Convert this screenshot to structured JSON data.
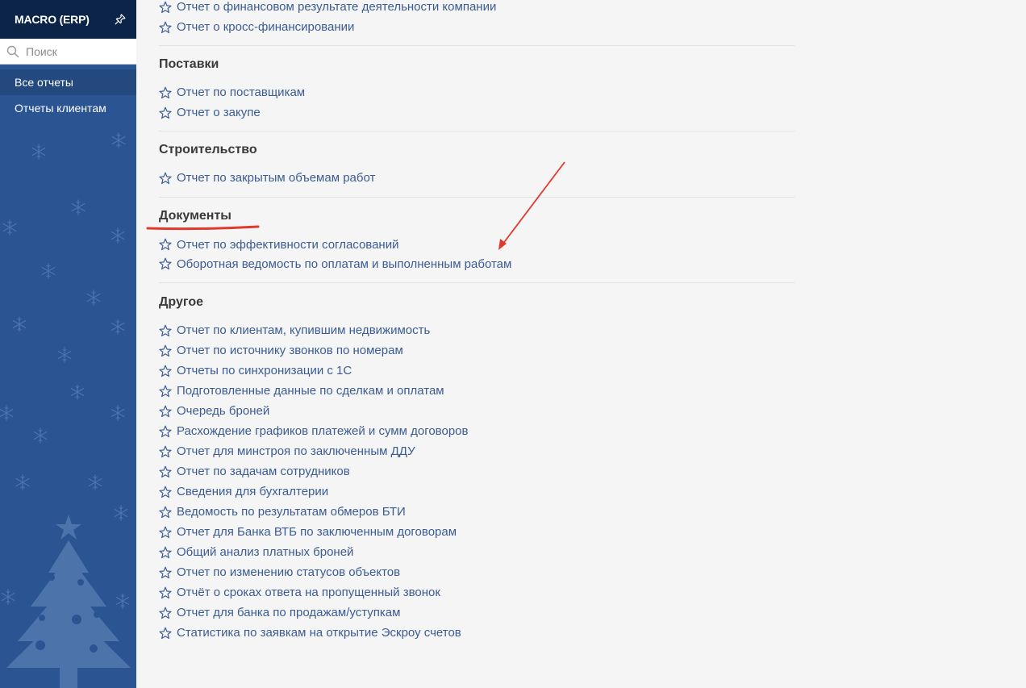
{
  "app": {
    "title": "MACRO (ERP)"
  },
  "search": {
    "placeholder": "Поиск",
    "value": ""
  },
  "sidebar": {
    "items": [
      {
        "label": "Все отчеты",
        "active": true
      },
      {
        "label": "Отчеты клиентам",
        "active": false
      }
    ]
  },
  "sections": [
    {
      "title": "",
      "reports": [
        "Отчет о финансовом результате деятельности компании",
        "Отчет о кросс-финансировании"
      ]
    },
    {
      "title": "Поставки",
      "reports": [
        "Отчет по поставщикам",
        "Отчет о закупе"
      ]
    },
    {
      "title": "Строительство",
      "reports": [
        "Отчет по закрытым объемам работ"
      ]
    },
    {
      "title": "Документы",
      "reports": [
        "Отчет по эффективности согласований",
        "Оборотная ведомость по оплатам и выполненным работам"
      ]
    },
    {
      "title": "Другое",
      "reports": [
        "Отчет по клиентам, купившим недвижимость",
        "Отчет по источнику звонков по номерам",
        "Отчеты по синхронизации с 1С",
        "Подготовленные данные по сделкам и оплатам",
        "Очередь броней",
        "Расхождение графиков платежей и сумм договоров",
        "Отчет для минстроя по заключенным ДДУ",
        "Отчет по задачам сотрудников",
        "Сведения для бухгалтерии",
        "Ведомость по результатам обмеров БТИ",
        "Отчет для Банка ВТБ по заключенным договорам",
        "Общий анализ платных броней",
        "Отчет по изменению статусов объектов",
        "Отчёт о сроках ответа на пропущенный звонок",
        "Отчет для банка по продажам/уступкам",
        "Статистика по заявкам на открытие Эскроу счетов"
      ]
    }
  ],
  "icons": {
    "pin": "pin-icon",
    "search": "search-icon",
    "favorite": "star-outline-icon"
  },
  "colors": {
    "sidebar_header": "#0c2447",
    "sidebar_bg": "#2a5592",
    "link": "#3b5c93",
    "annotation": "#e03a2f"
  }
}
